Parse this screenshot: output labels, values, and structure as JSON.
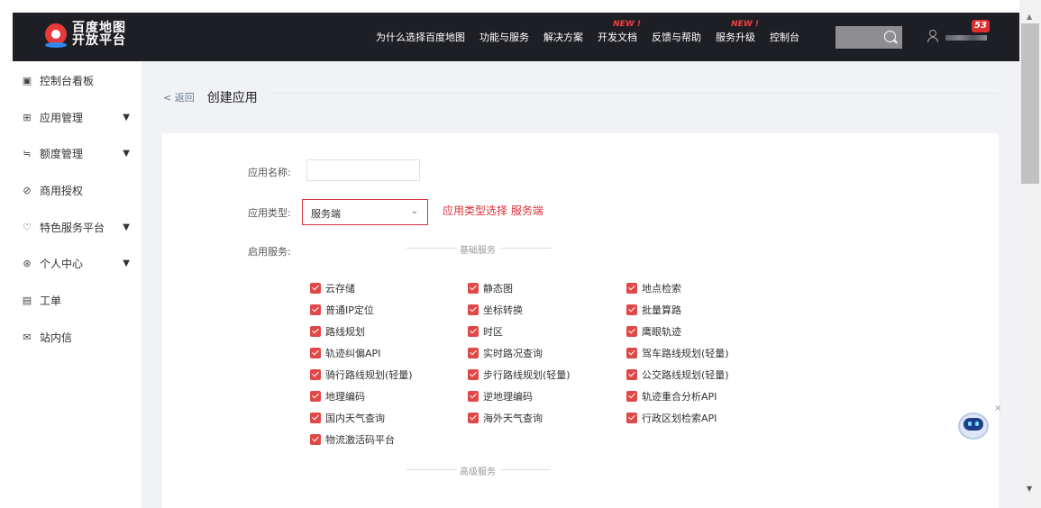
{
  "header": {
    "logo_text_line1": "百度地图",
    "logo_text_line2": "开放平台",
    "nav_items": [
      {
        "label": "为什么选择百度地图",
        "badge": ""
      },
      {
        "label": "功能与服务",
        "badge": ""
      },
      {
        "label": "解决方案",
        "badge": ""
      },
      {
        "label": "开发文档",
        "badge": "NEW !"
      },
      {
        "label": "反馈与帮助",
        "badge": ""
      },
      {
        "label": "服务升级",
        "badge": "NEW !"
      },
      {
        "label": "控制台",
        "badge": ""
      }
    ],
    "notification_count": "53",
    "icons": [
      "search-icon",
      "user-icon"
    ]
  },
  "sidebar": {
    "items": [
      {
        "label": "控制台看板",
        "icon": "dashboard-icon",
        "expandable": false
      },
      {
        "label": "应用管理",
        "icon": "grid-icon",
        "expandable": true
      },
      {
        "label": "额度管理",
        "icon": "sliders-icon",
        "expandable": true
      },
      {
        "label": "商用授权",
        "icon": "check-circle-icon",
        "expandable": false
      },
      {
        "label": "特色服务平台",
        "icon": "shield-icon",
        "expandable": true
      },
      {
        "label": "个人中心",
        "icon": "user-circle-icon",
        "expandable": true
      },
      {
        "label": "工单",
        "icon": "document-icon",
        "expandable": false
      },
      {
        "label": "站内信",
        "icon": "mail-icon",
        "expandable": false
      }
    ]
  },
  "main": {
    "back_label": "< 返回",
    "page_title": "创建应用",
    "form": {
      "name_label": "应用名称:",
      "name_value": "",
      "type_label": "应用类型:",
      "type_value": "服务端",
      "annotation": "应用类型选择 服务端",
      "services_label": "启用服务:",
      "basic_section_title": "基础服务",
      "advanced_section_title": "高级服务",
      "services": [
        {
          "label": "云存储",
          "checked": true
        },
        {
          "label": "静态图",
          "checked": true
        },
        {
          "label": "地点检索",
          "checked": true
        },
        {
          "label": "普通IP定位",
          "checked": true
        },
        {
          "label": "坐标转换",
          "checked": true
        },
        {
          "label": "批量算路",
          "checked": true
        },
        {
          "label": "路线规划",
          "checked": true
        },
        {
          "label": "时区",
          "checked": true
        },
        {
          "label": "鹰眼轨迹",
          "checked": true
        },
        {
          "label": "轨迹纠偏API",
          "checked": true
        },
        {
          "label": "实时路况查询",
          "checked": true
        },
        {
          "label": "驾车路线规划(轻量)",
          "checked": true
        },
        {
          "label": "骑行路线规划(轻量)",
          "checked": true
        },
        {
          "label": "步行路线规划(轻量)",
          "checked": true
        },
        {
          "label": "公交路线规划(轻量)",
          "checked": true
        },
        {
          "label": "地理编码",
          "checked": true
        },
        {
          "label": "逆地理编码",
          "checked": true
        },
        {
          "label": "轨迹重合分析API",
          "checked": true
        },
        {
          "label": "国内天气查询",
          "checked": true
        },
        {
          "label": "海外天气查询",
          "checked": true
        },
        {
          "label": "行政区划检索API",
          "checked": true
        },
        {
          "label": "物流激活码平台",
          "checked": true
        }
      ]
    }
  },
  "colors": {
    "nav_bg": "#1e1f24",
    "accent_red": "#d9323b",
    "checkbox_red": "#e04848",
    "content_bg": "#f0f2f5"
  }
}
